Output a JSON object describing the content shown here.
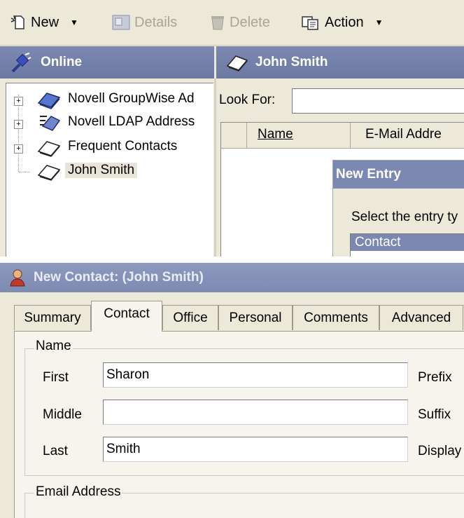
{
  "toolbar": {
    "new_label": "New",
    "details_label": "Details",
    "delete_label": "Delete",
    "action_label": "Action"
  },
  "left_panel": {
    "header": "Online",
    "tree": [
      {
        "label": "Novell GroupWise Ad",
        "expandable": true
      },
      {
        "label": "Novell LDAP Address",
        "expandable": true
      },
      {
        "label": "Frequent Contacts",
        "expandable": true
      },
      {
        "label": "John Smith",
        "expandable": false,
        "selected": true
      }
    ]
  },
  "right_panel": {
    "header": "John Smith",
    "look_for_label": "Look For:",
    "look_for_value": "",
    "columns": [
      "Name",
      "E-Mail Addre"
    ]
  },
  "new_entry_dialog": {
    "title": "New Entry",
    "prompt": "Select the entry ty",
    "options": [
      "Contact"
    ]
  },
  "new_contact_dialog": {
    "title": "New Contact: (John Smith)",
    "tabs": [
      "Summary",
      "Contact",
      "Office",
      "Personal",
      "Comments",
      "Advanced"
    ],
    "active_tab": "Contact",
    "name_group": {
      "title": "Name",
      "first_label": "First",
      "first_value": "Sharon",
      "middle_label": "Middle",
      "middle_value": "",
      "last_label": "Last",
      "last_value": "Smith",
      "prefix_label": "Prefix",
      "suffix_label": "Suffix",
      "display_label": "Display"
    },
    "email_group": {
      "title": "Email Address"
    }
  },
  "colors": {
    "header_bg": "#7b89b2",
    "window_bg": "#ece9d8",
    "selection_bg": "#7b89b2"
  }
}
